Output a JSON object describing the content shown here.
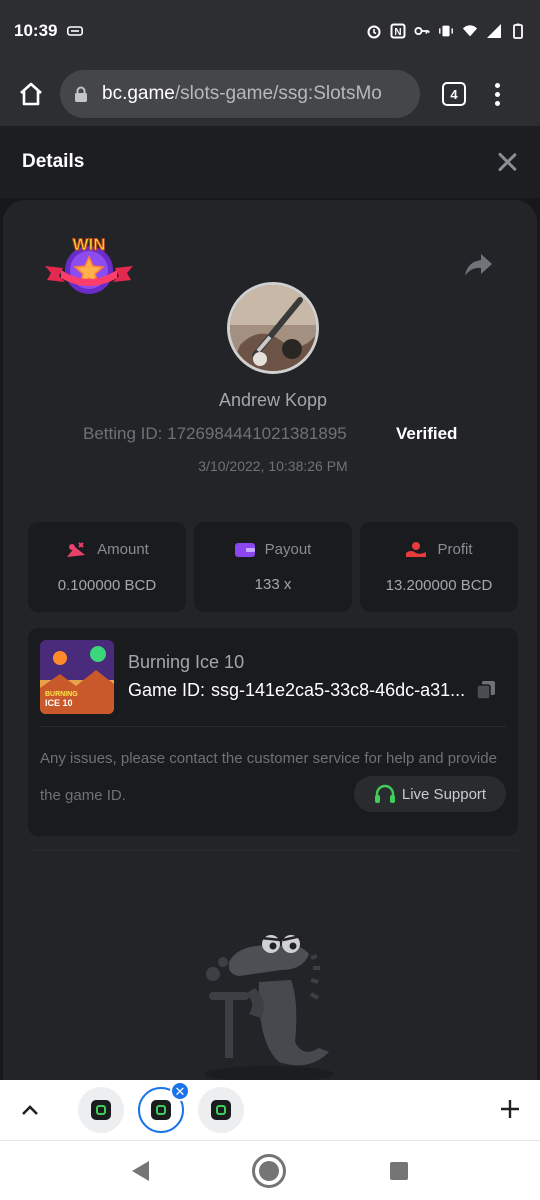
{
  "status_bar": {
    "time": "10:39"
  },
  "browser": {
    "url_domain": "bc.game",
    "url_path": "/slots-game/ssg:SlotsMo",
    "tab_count": "4"
  },
  "details": {
    "title": "Details",
    "username": "Andrew Kopp",
    "betting_id_label": "Betting ID:",
    "betting_id": "1726984441021381895",
    "verified": "Verified",
    "timestamp": "3/10/2022, 10:38:26 PM",
    "stats": [
      {
        "label": "Amount",
        "value": "0.100000 BCD",
        "icon": "amount-icon",
        "color": "#e8416a"
      },
      {
        "label": "Payout",
        "value": "133 x",
        "icon": "wallet-icon",
        "color": "#8b46f0"
      },
      {
        "label": "Profit",
        "value": "13.200000 BCD",
        "icon": "profit-icon",
        "color": "#e83b3b"
      }
    ],
    "game": {
      "name": "Burning Ice 10",
      "id_label": "Game ID:",
      "id": "ssg-141e2ca5-33c8-46dc-a31...",
      "thumb_text": "BURNING ICE 10"
    },
    "support_text": "Any issues, please contact the customer service for help and provide the game ID.",
    "live_support": "Live Support",
    "badge_text": "WIN"
  },
  "colors": {
    "accent_green": "#3fce5a",
    "tab_active": "#1a73e8",
    "verified": "#ffffff"
  }
}
